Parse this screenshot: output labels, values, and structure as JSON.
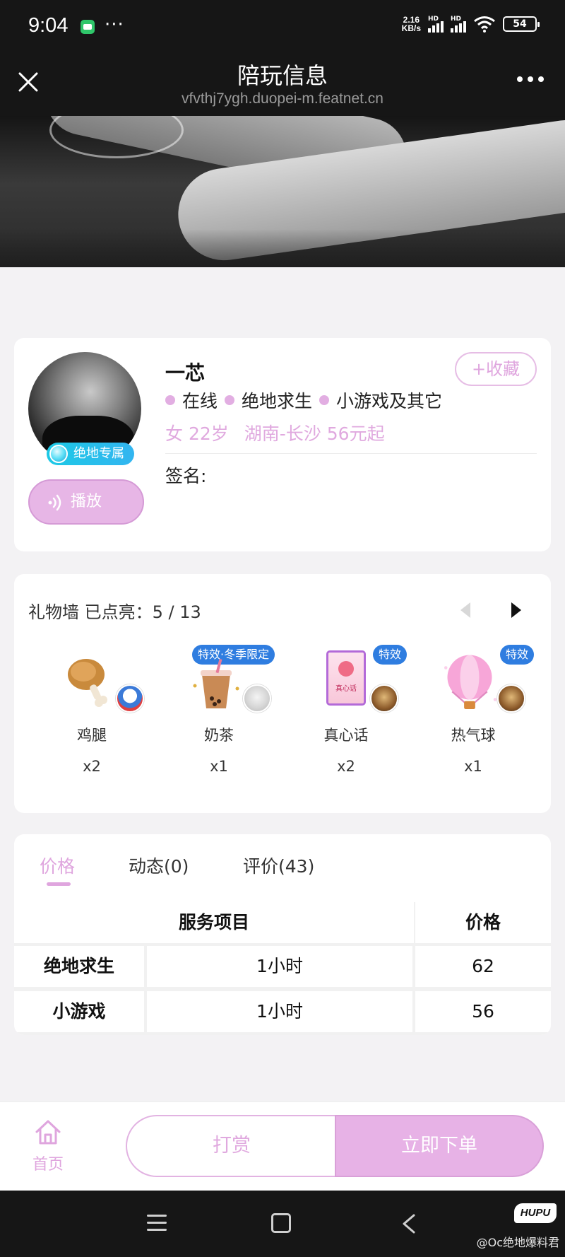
{
  "status_bar": {
    "time": "9:04",
    "dots": "···",
    "net_speed_value": "2.16",
    "net_speed_unit": "KB/s",
    "signal_label_1": "HD",
    "signal_label_2": "HD",
    "battery": "54",
    "icons": [
      "message-icon",
      "signal-icon",
      "wifi-icon",
      "battery-icon"
    ]
  },
  "nav": {
    "title": "陪玩信息",
    "url": "vfvthj7ygh.duopei-m.featnet.cn"
  },
  "profile": {
    "nickname": "一芯",
    "favorite_label": "+收藏",
    "badge": "绝地专属",
    "play_label": "播放",
    "tags": [
      "在线",
      "绝地求生",
      "小游戏及其它"
    ],
    "gender": "女",
    "age": "22岁",
    "location": "湖南-长沙",
    "price_from": "56元起",
    "signature_label": "签名:"
  },
  "gift_wall": {
    "title": "礼物墙 已点亮：5 / 13",
    "gifts": [
      {
        "name": "鸡腿",
        "count": "x2",
        "badge": ""
      },
      {
        "name": "奶茶",
        "count": "x1",
        "badge": "特效·冬季限定"
      },
      {
        "name": "真心话",
        "count": "x2",
        "badge": "特效",
        "card_text": "真心话"
      },
      {
        "name": "热气球",
        "count": "x1",
        "badge": "特效"
      }
    ]
  },
  "tabs": [
    {
      "label": "价格",
      "active": true
    },
    {
      "label": "动态(0)",
      "active": false
    },
    {
      "label": "评价(43)",
      "active": false
    }
  ],
  "price_table": {
    "headers": [
      "服务项目",
      "价格"
    ],
    "rows": [
      {
        "item": "绝地求生",
        "duration": "1小时",
        "price": "62"
      },
      {
        "item": "小游戏",
        "duration": "1小时",
        "price": "56"
      }
    ]
  },
  "bottom_bar": {
    "home_label": "首页",
    "tip_label": "打赏",
    "order_label": "立即下单"
  },
  "watermark": {
    "logo": "HUPU",
    "text": "@Oc绝地爆料君"
  },
  "colors": {
    "accent": "#e2aee2",
    "dark_bar": "#161616",
    "badge_blue": "#2f7de0",
    "exclusive_cyan": "#1cc9e6"
  }
}
